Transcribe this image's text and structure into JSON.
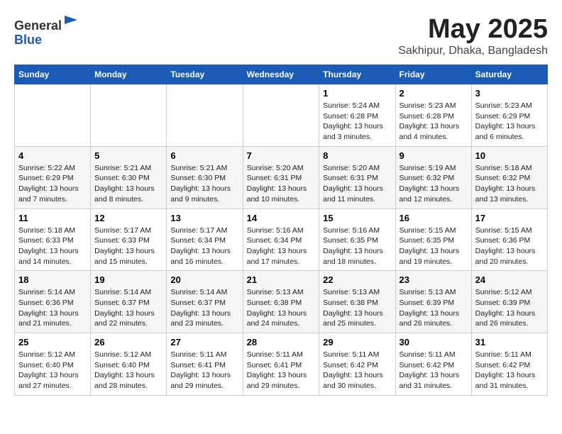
{
  "header": {
    "logo_general": "General",
    "logo_blue": "Blue",
    "month": "May 2025",
    "location": "Sakhipur, Dhaka, Bangladesh"
  },
  "columns": [
    "Sunday",
    "Monday",
    "Tuesday",
    "Wednesday",
    "Thursday",
    "Friday",
    "Saturday"
  ],
  "weeks": [
    [
      {
        "day": "",
        "info": ""
      },
      {
        "day": "",
        "info": ""
      },
      {
        "day": "",
        "info": ""
      },
      {
        "day": "",
        "info": ""
      },
      {
        "day": "1",
        "info": "Sunrise: 5:24 AM\nSunset: 6:28 PM\nDaylight: 13 hours\nand 3 minutes."
      },
      {
        "day": "2",
        "info": "Sunrise: 5:23 AM\nSunset: 6:28 PM\nDaylight: 13 hours\nand 4 minutes."
      },
      {
        "day": "3",
        "info": "Sunrise: 5:23 AM\nSunset: 6:29 PM\nDaylight: 13 hours\nand 6 minutes."
      }
    ],
    [
      {
        "day": "4",
        "info": "Sunrise: 5:22 AM\nSunset: 6:29 PM\nDaylight: 13 hours\nand 7 minutes."
      },
      {
        "day": "5",
        "info": "Sunrise: 5:21 AM\nSunset: 6:30 PM\nDaylight: 13 hours\nand 8 minutes."
      },
      {
        "day": "6",
        "info": "Sunrise: 5:21 AM\nSunset: 6:30 PM\nDaylight: 13 hours\nand 9 minutes."
      },
      {
        "day": "7",
        "info": "Sunrise: 5:20 AM\nSunset: 6:31 PM\nDaylight: 13 hours\nand 10 minutes."
      },
      {
        "day": "8",
        "info": "Sunrise: 5:20 AM\nSunset: 6:31 PM\nDaylight: 13 hours\nand 11 minutes."
      },
      {
        "day": "9",
        "info": "Sunrise: 5:19 AM\nSunset: 6:32 PM\nDaylight: 13 hours\nand 12 minutes."
      },
      {
        "day": "10",
        "info": "Sunrise: 5:18 AM\nSunset: 6:32 PM\nDaylight: 13 hours\nand 13 minutes."
      }
    ],
    [
      {
        "day": "11",
        "info": "Sunrise: 5:18 AM\nSunset: 6:33 PM\nDaylight: 13 hours\nand 14 minutes."
      },
      {
        "day": "12",
        "info": "Sunrise: 5:17 AM\nSunset: 6:33 PM\nDaylight: 13 hours\nand 15 minutes."
      },
      {
        "day": "13",
        "info": "Sunrise: 5:17 AM\nSunset: 6:34 PM\nDaylight: 13 hours\nand 16 minutes."
      },
      {
        "day": "14",
        "info": "Sunrise: 5:16 AM\nSunset: 6:34 PM\nDaylight: 13 hours\nand 17 minutes."
      },
      {
        "day": "15",
        "info": "Sunrise: 5:16 AM\nSunset: 6:35 PM\nDaylight: 13 hours\nand 18 minutes."
      },
      {
        "day": "16",
        "info": "Sunrise: 5:15 AM\nSunset: 6:35 PM\nDaylight: 13 hours\nand 19 minutes."
      },
      {
        "day": "17",
        "info": "Sunrise: 5:15 AM\nSunset: 6:36 PM\nDaylight: 13 hours\nand 20 minutes."
      }
    ],
    [
      {
        "day": "18",
        "info": "Sunrise: 5:14 AM\nSunset: 6:36 PM\nDaylight: 13 hours\nand 21 minutes."
      },
      {
        "day": "19",
        "info": "Sunrise: 5:14 AM\nSunset: 6:37 PM\nDaylight: 13 hours\nand 22 minutes."
      },
      {
        "day": "20",
        "info": "Sunrise: 5:14 AM\nSunset: 6:37 PM\nDaylight: 13 hours\nand 23 minutes."
      },
      {
        "day": "21",
        "info": "Sunrise: 5:13 AM\nSunset: 6:38 PM\nDaylight: 13 hours\nand 24 minutes."
      },
      {
        "day": "22",
        "info": "Sunrise: 5:13 AM\nSunset: 6:38 PM\nDaylight: 13 hours\nand 25 minutes."
      },
      {
        "day": "23",
        "info": "Sunrise: 5:13 AM\nSunset: 6:39 PM\nDaylight: 13 hours\nand 26 minutes."
      },
      {
        "day": "24",
        "info": "Sunrise: 5:12 AM\nSunset: 6:39 PM\nDaylight: 13 hours\nand 26 minutes."
      }
    ],
    [
      {
        "day": "25",
        "info": "Sunrise: 5:12 AM\nSunset: 6:40 PM\nDaylight: 13 hours\nand 27 minutes."
      },
      {
        "day": "26",
        "info": "Sunrise: 5:12 AM\nSunset: 6:40 PM\nDaylight: 13 hours\nand 28 minutes."
      },
      {
        "day": "27",
        "info": "Sunrise: 5:11 AM\nSunset: 6:41 PM\nDaylight: 13 hours\nand 29 minutes."
      },
      {
        "day": "28",
        "info": "Sunrise: 5:11 AM\nSunset: 6:41 PM\nDaylight: 13 hours\nand 29 minutes."
      },
      {
        "day": "29",
        "info": "Sunrise: 5:11 AM\nSunset: 6:42 PM\nDaylight: 13 hours\nand 30 minutes."
      },
      {
        "day": "30",
        "info": "Sunrise: 5:11 AM\nSunset: 6:42 PM\nDaylight: 13 hours\nand 31 minutes."
      },
      {
        "day": "31",
        "info": "Sunrise: 5:11 AM\nSunset: 6:42 PM\nDaylight: 13 hours\nand 31 minutes."
      }
    ]
  ]
}
